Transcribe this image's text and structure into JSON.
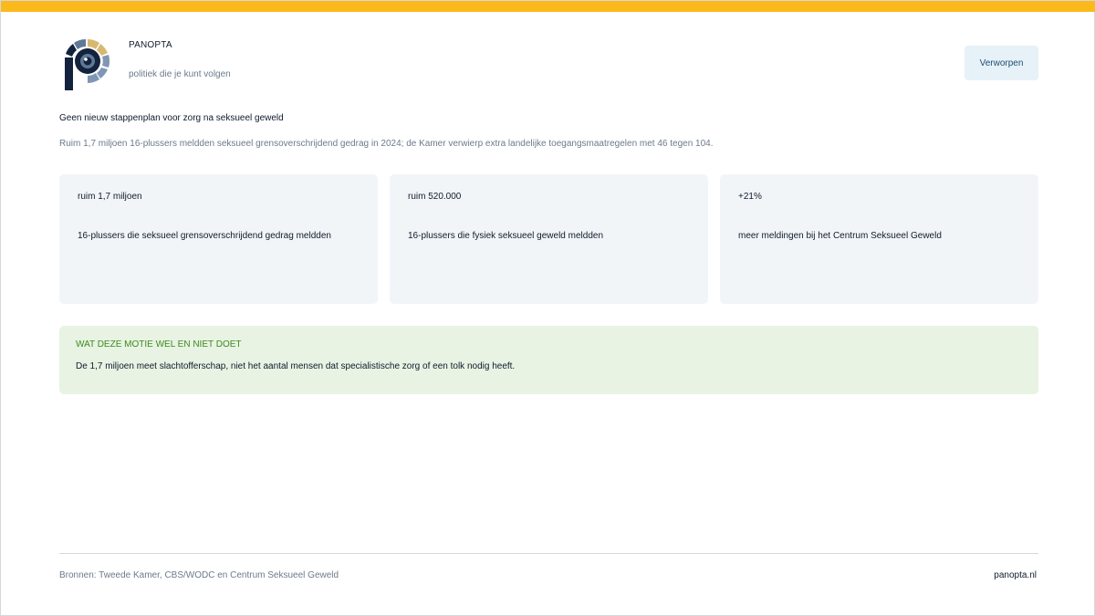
{
  "brand": {
    "name": "PANOPTA",
    "tagline": "politiek die je kunt volgen",
    "colors": {
      "accent": "#fbb91c",
      "navy": "#14233d",
      "gold": "#d8b870",
      "blue_gray": "#7f96b4"
    }
  },
  "status": {
    "label": "Verworpen"
  },
  "article": {
    "headline": "Geen nieuw stappenplan voor zorg na seksueel geweld",
    "summary": "Ruim 1,7 miljoen 16-plussers meldden seksueel grensoverschrijdend gedrag in 2024; de Kamer verwierp extra landelijke toegangsmaatregelen met 46 tegen 104."
  },
  "stats": [
    {
      "value": "ruim 1,7 miljoen",
      "label": "16-plussers die seksueel grensoverschrijdend gedrag meldden"
    },
    {
      "value": "ruim 520.000",
      "label": "16-plussers die fysiek seksueel geweld meldden"
    },
    {
      "value": "+21%",
      "label": "meer meldingen bij het Centrum Seksueel Geweld"
    }
  ],
  "notice": {
    "title": "WAT DEZE MOTIE WEL EN NIET DOET",
    "text": "De 1,7 miljoen meet slachtofferschap, niet het aantal mensen dat specialistische zorg of een tolk nodig heeft."
  },
  "footer": {
    "sources": "Bronnen: Tweede Kamer, CBS/WODC en Centrum Seksueel Geweld",
    "site": "panopta.nl"
  }
}
